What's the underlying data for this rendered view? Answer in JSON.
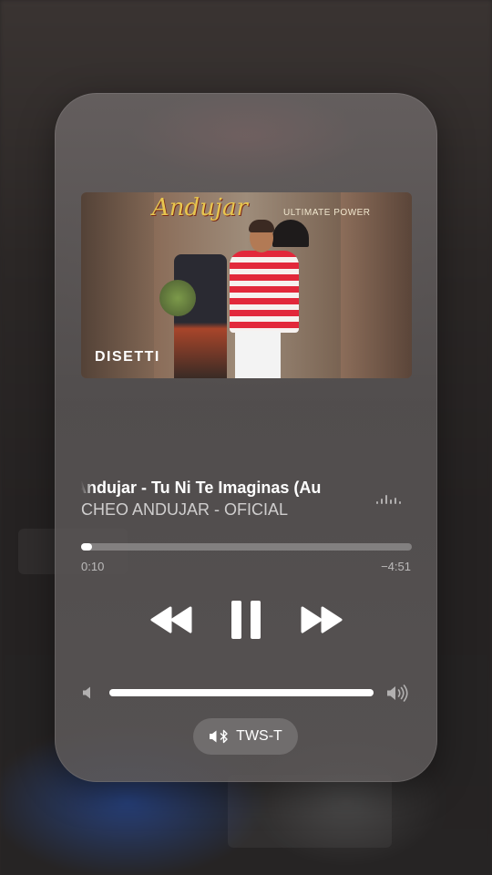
{
  "now_playing": {
    "title": "Andujar - Tu Ni Te Imaginas (Au",
    "artist": "CHEO ANDUJAR - OFICIAL",
    "elapsed": "0:10",
    "remaining": "−4:51",
    "progress_fraction": 0.034,
    "volume_fraction": 1.0
  },
  "artwork": {
    "logo_text": "Andujar",
    "power_text": "ULTIMATE POWER",
    "label_text": "DISETTI"
  },
  "controls": {
    "rewind_icon": "backward-icon",
    "pause_icon": "pause-icon",
    "forward_icon": "forward-icon",
    "volume_low_icon": "speaker-low-icon",
    "volume_high_icon": "speaker-high-icon"
  },
  "output_device": {
    "name": "TWS-T",
    "icon": "bluetooth-speaker-icon"
  },
  "colors": {
    "accent": "#ffffff",
    "panel": "#5c5858"
  }
}
